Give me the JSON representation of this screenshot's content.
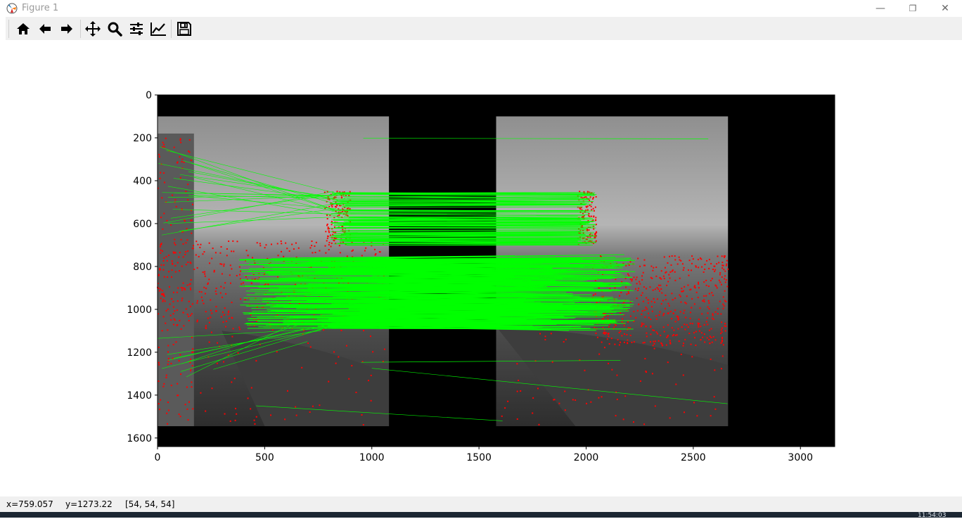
{
  "window": {
    "title": "Figure 1",
    "minimize_glyph": "—",
    "maximize_glyph": "❐",
    "close_glyph": "✕"
  },
  "toolbar": {
    "buttons": [
      {
        "name": "home-icon",
        "tooltip": "Home"
      },
      {
        "name": "back-arrow-icon",
        "tooltip": "Back"
      },
      {
        "name": "forward-arrow-icon",
        "tooltip": "Forward"
      },
      {
        "name": "pan-icon",
        "tooltip": "Pan"
      },
      {
        "name": "zoom-icon",
        "tooltip": "Zoom"
      },
      {
        "name": "subplots-config-icon",
        "tooltip": "Configure subplots"
      },
      {
        "name": "edit-axis-icon",
        "tooltip": "Edit axis"
      },
      {
        "name": "save-icon",
        "tooltip": "Save"
      }
    ]
  },
  "plot": {
    "description_type": "image-with-feature-matches",
    "x_ticks": [
      "0",
      "500",
      "1000",
      "1500",
      "2000",
      "2500",
      "3000"
    ],
    "y_ticks": [
      "0",
      "200",
      "400",
      "600",
      "800",
      "1000",
      "1200",
      "1400",
      "1600"
    ],
    "x_range": [
      0,
      3160
    ],
    "y_range": [
      1640,
      0
    ],
    "background_color": "#000000",
    "match_color": "#00ff00",
    "keypoint_color": "#ff0000"
  },
  "status": {
    "x": "x=759.057",
    "y": "y=1273.22",
    "pixel": "[54, 54, 54]"
  },
  "taskbar": {
    "clock": "11:54:03"
  },
  "chart_data": {
    "type": "image",
    "x_ticks": [
      0,
      500,
      1000,
      1500,
      2000,
      2500,
      3000
    ],
    "y_ticks": [
      0,
      200,
      400,
      600,
      800,
      1000,
      1200,
      1400,
      1600
    ],
    "xlim": [
      0,
      3160
    ],
    "ylim": [
      1640,
      0
    ],
    "images": [
      {
        "x0": 0,
        "x1": 1080,
        "y0": 100,
        "y1": 1545
      },
      {
        "x0": 1580,
        "x1": 2662,
        "y0": 100,
        "y1": 1545
      }
    ]
  }
}
